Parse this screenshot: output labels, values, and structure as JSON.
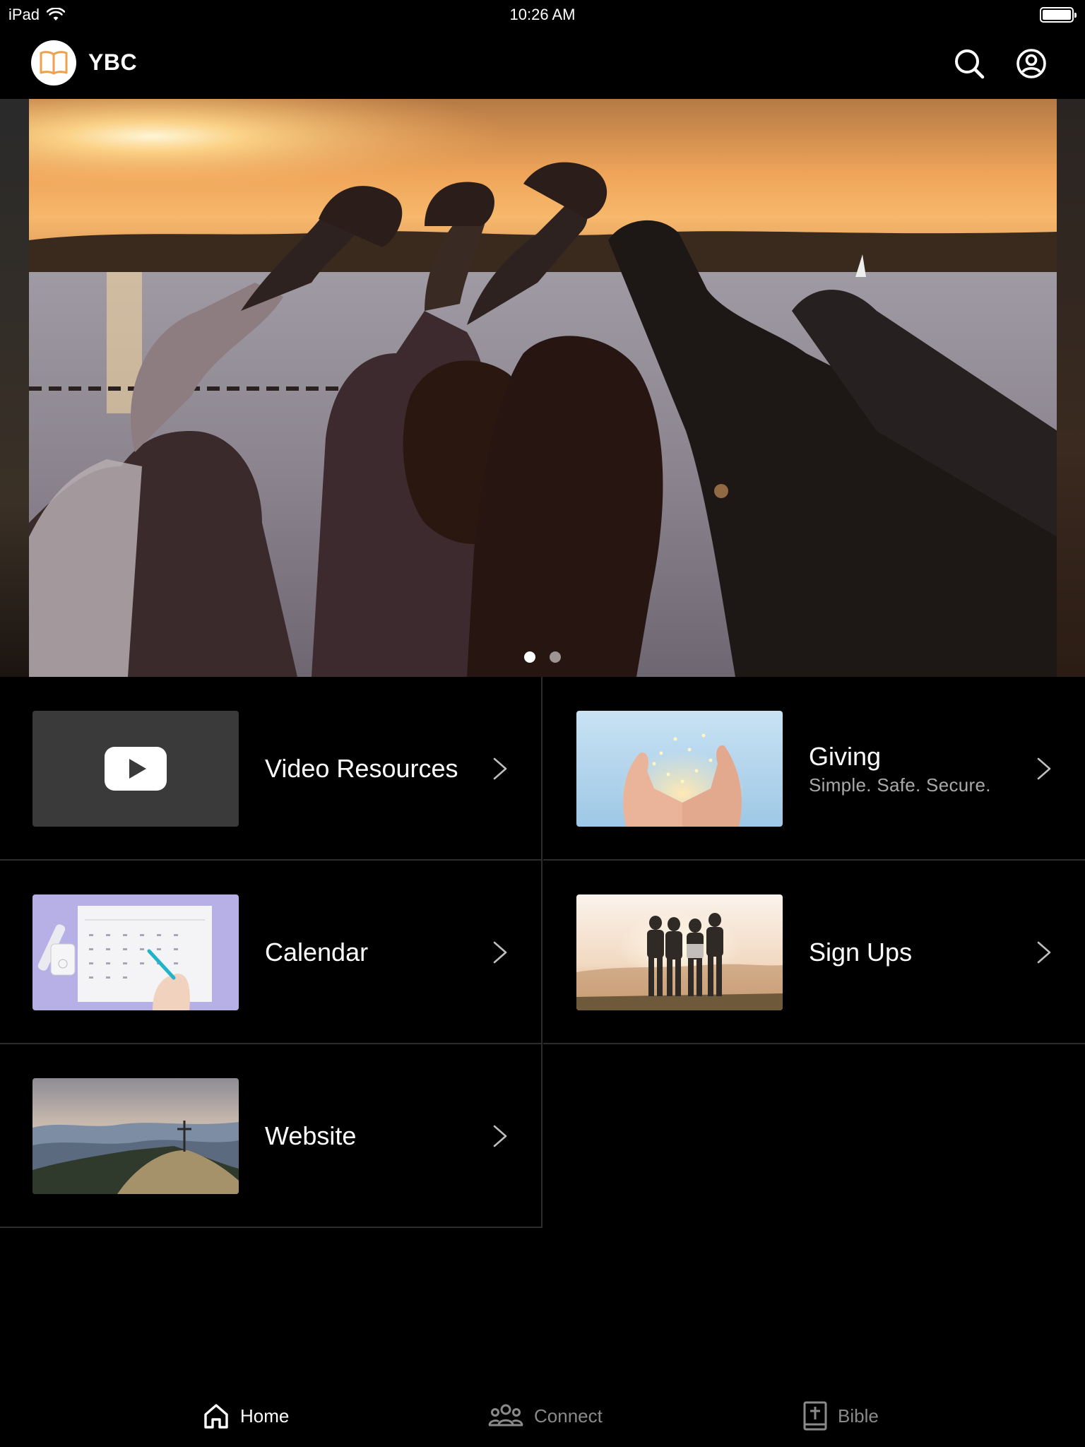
{
  "status_bar": {
    "device": "iPad",
    "time": "10:26 AM"
  },
  "header": {
    "title": "YBC",
    "logo_icon": "open-book-icon",
    "search_icon": "search-icon",
    "account_icon": "user-circle-icon",
    "logo_color": "#F0A04B"
  },
  "hero": {
    "slide_count": 2,
    "active_index": 0
  },
  "tiles": [
    {
      "title": "Video Resources",
      "subtitle": "",
      "thumb": "youtube-logo"
    },
    {
      "title": "Giving",
      "subtitle": "Simple. Safe. Secure.",
      "thumb": "hands-with-lights"
    },
    {
      "title": "Calendar",
      "subtitle": "",
      "thumb": "calendar-paper"
    },
    {
      "title": "Sign Ups",
      "subtitle": "",
      "thumb": "friends-sunset"
    },
    {
      "title": "Website",
      "subtitle": "",
      "thumb": "mountain-cross"
    }
  ],
  "tabbar": {
    "tabs": [
      {
        "label": "Home",
        "icon": "home-icon",
        "active": true
      },
      {
        "label": "Connect",
        "icon": "group-icon",
        "active": false
      },
      {
        "label": "Bible",
        "icon": "bible-icon",
        "active": false
      }
    ]
  }
}
